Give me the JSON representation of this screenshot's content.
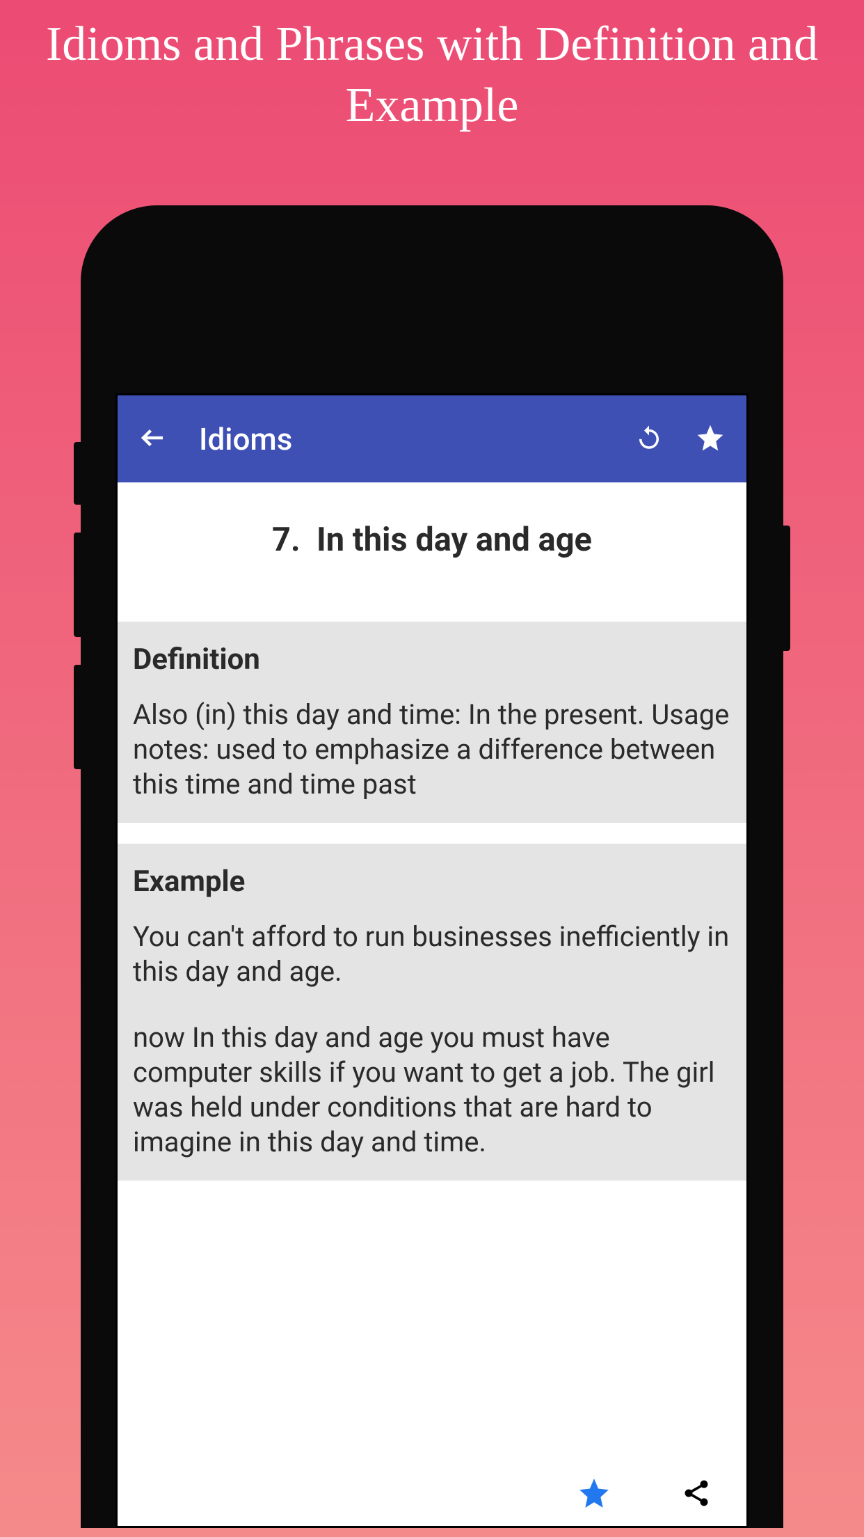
{
  "promo": {
    "title": "Idioms and Phrases with Definition and Example"
  },
  "appBar": {
    "title": "Idioms"
  },
  "idiom": {
    "number": "7.",
    "title": "In this day and age"
  },
  "definition": {
    "heading": "Definition",
    "text": "Also (in) this day and time: In the present. Usage notes: used to emphasize a difference between this time and time past"
  },
  "example": {
    "heading": "Example",
    "text1": "You can't afford to run businesses inefficiently in this day and age.",
    "text2": "now In this day and age you must have computer skills if you want to get a job. The girl was held under conditions that are hard to imagine in this day and time."
  }
}
